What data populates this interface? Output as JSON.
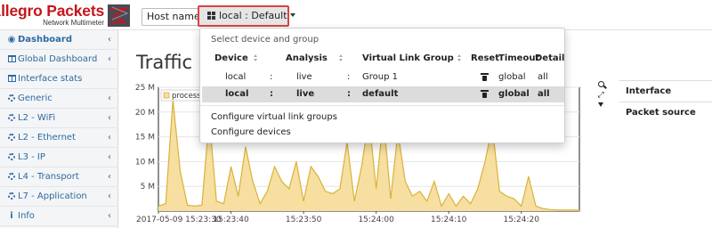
{
  "brand": {
    "name": "Allegro Packets",
    "subtitle": "Network Multimeter"
  },
  "host": {
    "label": "Host name:",
    "selected": "local : Default"
  },
  "sidebar": {
    "items": [
      {
        "label": "Dashboard",
        "icon": "dashboard-icon",
        "active": true
      },
      {
        "label": "Global Dashboard",
        "icon": "table-icon"
      },
      {
        "label": "Interface stats",
        "icon": "table-icon"
      },
      {
        "label": "Generic",
        "icon": "gear-icon"
      },
      {
        "label": "L2 - WiFi",
        "icon": "gear-icon"
      },
      {
        "label": "L2 - Ethernet",
        "icon": "gear-icon"
      },
      {
        "label": "L3 - IP",
        "icon": "gear-icon"
      },
      {
        "label": "L4 - Transport",
        "icon": "gear-icon"
      },
      {
        "label": "L7 - Application",
        "icon": "gear-icon"
      },
      {
        "label": "Info",
        "icon": "info-icon"
      }
    ]
  },
  "main": {
    "title": "Traffic c"
  },
  "dropdown": {
    "header": "Select device and group",
    "columns": [
      "Device",
      "Analysis",
      "Virtual Link Group",
      "Reset",
      "Timeout",
      "Detail"
    ],
    "rows": [
      {
        "device": "local",
        "analysis": "live",
        "group": "Group 1",
        "timeout": "global",
        "detail": "all",
        "selected": false
      },
      {
        "device": "local",
        "analysis": "live",
        "group": "default",
        "timeout": "global",
        "detail": "all",
        "selected": true
      }
    ],
    "separator": ":",
    "links": [
      "Configure virtual link groups",
      "Configure devices"
    ]
  },
  "info_panel": {
    "rows": [
      "Interface",
      "Packet source"
    ]
  },
  "colors": {
    "brand": "#c4161c",
    "accent": "#2c6aa0",
    "area_fill": "#f6dfa0",
    "area_line": "#d9b23a",
    "highlight_border": "#d9433d"
  },
  "chart_data": {
    "type": "area",
    "y_ticks": [
      "25 M",
      "20 M",
      "15 M",
      "10 M",
      "5 M"
    ],
    "ylim": [
      0,
      25000000
    ],
    "x_ticks": [
      "2017-05-09 15:23:30",
      "15:23:40",
      "15:23:50",
      "15:24:00",
      "15:24:10",
      "15:24:20"
    ],
    "xlim": [
      0,
      58
    ],
    "legend": "processe",
    "series": [
      {
        "name": "processe",
        "x": [
          0,
          1,
          2,
          3,
          4,
          5,
          6,
          7,
          8,
          9,
          10,
          11,
          12,
          13,
          14,
          15,
          16,
          17,
          18,
          19,
          20,
          21,
          22,
          23,
          24,
          25,
          26,
          27,
          28,
          29,
          30,
          31,
          32,
          33,
          34,
          35,
          36,
          37,
          38,
          39,
          40,
          41,
          42,
          43,
          44,
          45,
          46,
          47,
          48,
          49,
          50,
          51,
          52,
          53,
          54,
          55,
          56,
          57,
          58
        ],
        "values": [
          1000000,
          1500000,
          22500000,
          8000000,
          1200000,
          1000000,
          1200000,
          19000000,
          2000000,
          1500000,
          9000000,
          3000000,
          13000000,
          6000000,
          1500000,
          4000000,
          9000000,
          6000000,
          4500000,
          10000000,
          2000000,
          9000000,
          7000000,
          4000000,
          3500000,
          4500000,
          14000000,
          2000000,
          9000000,
          19000000,
          4500000,
          19000000,
          2500000,
          16000000,
          6000000,
          3000000,
          4000000,
          2000000,
          6000000,
          1000000,
          3500000,
          1000000,
          3000000,
          1500000,
          4500000,
          10000000,
          17000000,
          4000000,
          3000000,
          2500000,
          1000000,
          7000000,
          1000000,
          500000,
          300000,
          200000,
          200000,
          200000,
          200000
        ]
      }
    ]
  }
}
